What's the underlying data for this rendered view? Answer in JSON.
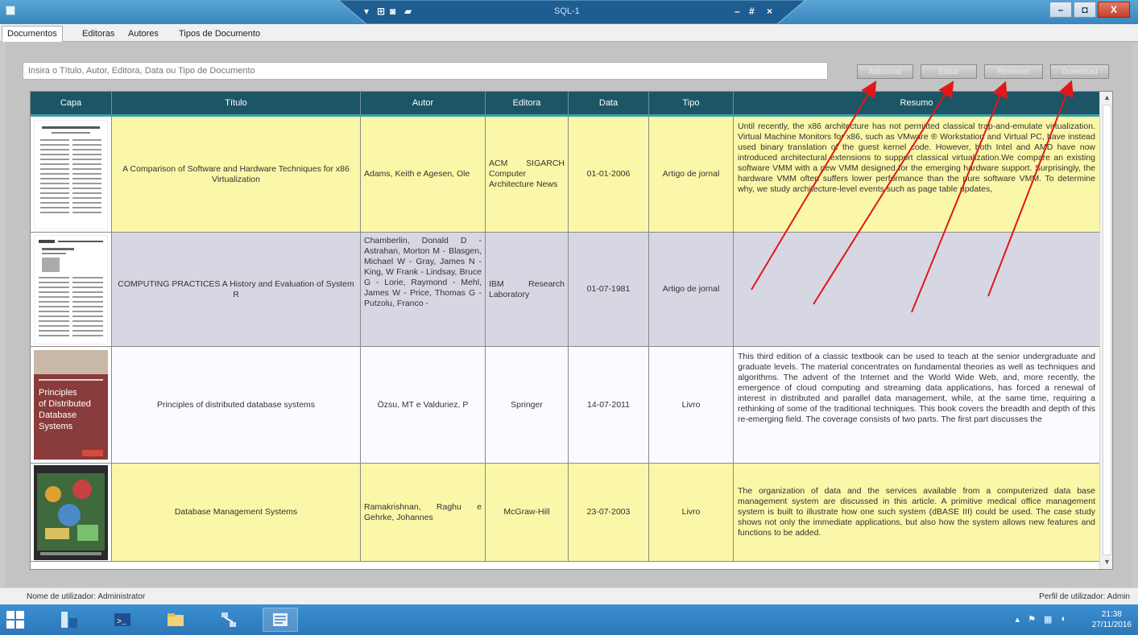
{
  "remote_bar": {
    "title": "SQL-1"
  },
  "window": {
    "minimize": "–",
    "maximize": "◘",
    "close": "X"
  },
  "tabs": [
    {
      "label": "Documentos"
    },
    {
      "label": "Editoras"
    },
    {
      "label": "Autores"
    },
    {
      "label": "Tipos de Documento"
    }
  ],
  "search": {
    "placeholder": "Insira o Título, Autor, Editora, Data ou Tipo de Documento"
  },
  "buttons": {
    "adicionar": "Adicionar",
    "editar": "Editar",
    "remover": "Remover",
    "download": "Download"
  },
  "table": {
    "headers": [
      "Capa",
      "Título",
      "Autor",
      "Editora",
      "Data",
      "Tipo",
      "Resumo"
    ],
    "rows": [
      {
        "titulo": "A Comparison of Software and Hardware Techniques for x86 Virtualization",
        "autor": "Adams, Keith e Agesen, Ole",
        "editora": "ACM SIGARCH Computer Architecture News",
        "data": "01-01-2006",
        "tipo": "Artigo de jornal",
        "resumo": "Until recently, the x86 architecture has not permitted classical trap-and-emulate virtualization. Virtual Machine Monitors for x86, such as VMware ® Workstation and Virtual PC, have instead used binary translation of the guest kernel code. However, both Intel and AMD have now introduced architectural extensions to support classical virtualization.We compare an existing software VMM with a new VMM designed for the emerging hardware support. Surprisingly, the hardware VMM often suffers lower performance than the pure software VMM. To determine why, we study architecture-level events such as page table updates,",
        "color": "#faf7a8"
      },
      {
        "titulo": "COMPUTING PRACTICES A History and Evaluation of System R",
        "autor": "Chamberlin, Donald D - Astrahan, Morton M - Blasgen, Michael W - Gray, James N - King, W Frank - Lindsay, Bruce G - Lorie, Raymond - Mehl, James W - Price, Thomas G - Putzolu, Franco -",
        "editora": "IBM Research Laboratory",
        "data": "01-07-1981",
        "tipo": "Artigo de jornal",
        "resumo": "",
        "color": "#d7d7e3"
      },
      {
        "titulo": "Principles of distributed database systems",
        "autor": "Özsu, MT e Valduriez, P",
        "editora": "Springer",
        "data": "14-07-2011",
        "tipo": "Livro",
        "resumo": "This third edition of a classic textbook can be used to teach at the senior undergraduate and graduate levels. The material concentrates on fundamental theories as well as techniques and algorithms. The advent of the Internet and the World Wide Web, and, more recently, the emergence of cloud computing and streaming data applications, has forced a renewal of interest in distributed and parallel data management, while, at the same time, requiring a rethinking of some of the traditional techniques. This book covers the breadth and depth of this re-emerging field. The coverage consists of two parts. The first part discusses the",
        "cover_text": "Principles of Distributed Database Systems",
        "color": "#fbfbff"
      },
      {
        "titulo": "Database Management Systems",
        "autor": "Ramakrishnan, Raghu e Gehrke, Johannes",
        "editora": "McGraw-Hill",
        "data": "23-07-2003",
        "tipo": "Livro",
        "resumo": "The organization of data and the services available from a computerized data base management system are discussed in this article. A primitive medical office management system is built to illustrate how one such system (dBASE III) could be used. The case study shows not only the immediate applications, but also how the system allows new features and functions to be added.",
        "color": "#faf7a8"
      }
    ]
  },
  "status": {
    "user": "Nome de utilizador: Administrator",
    "profile": "Perfil de utilizador: Admin"
  },
  "clock": {
    "time": "21:38",
    "date": "27/11/2016"
  }
}
